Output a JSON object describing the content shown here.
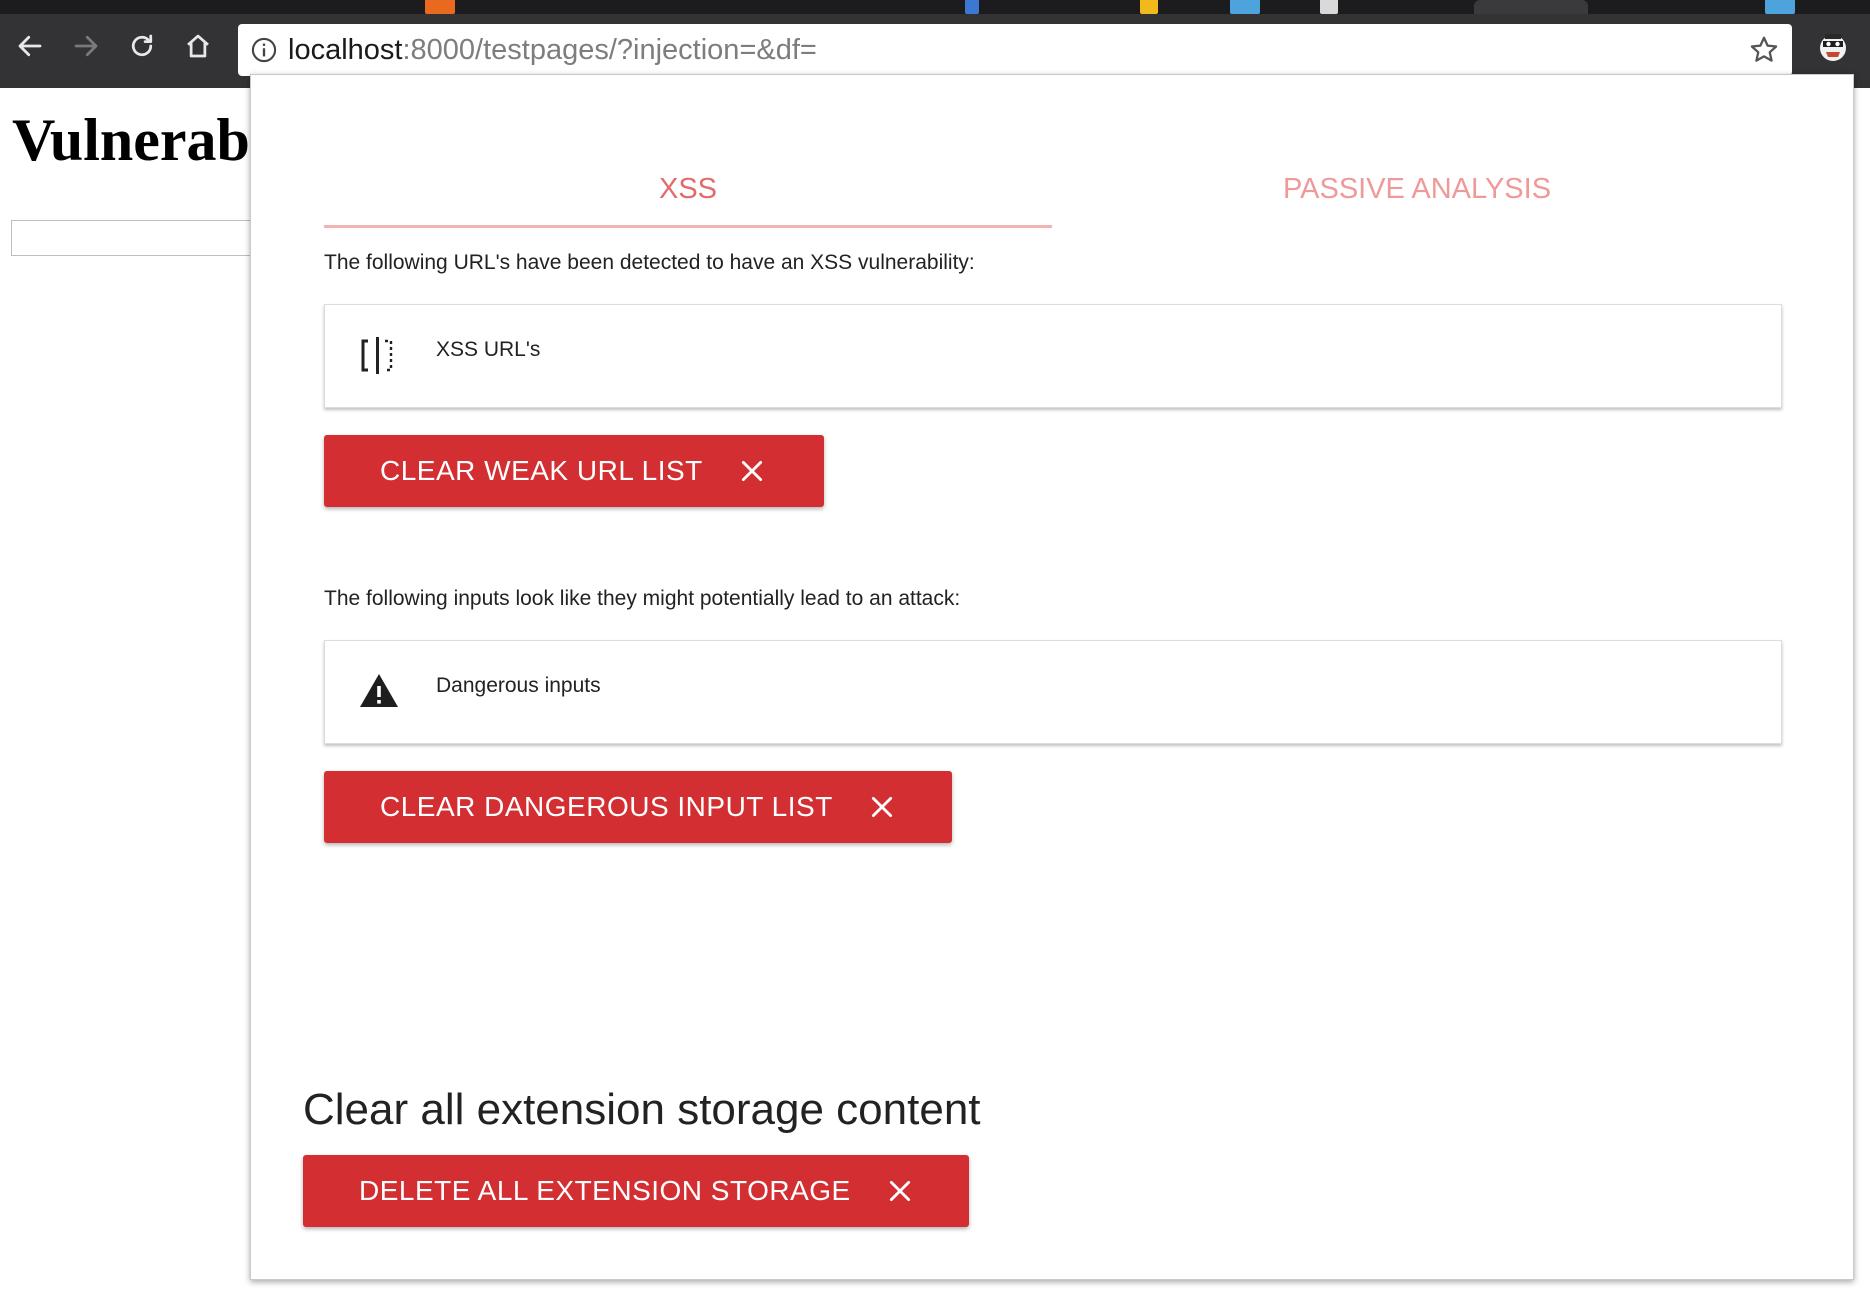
{
  "browser": {
    "url_host": "localhost",
    "url_rest": ":8000/testpages/?injection=&df=",
    "icons": [
      "back-icon",
      "forward-icon",
      "reload-icon",
      "home-icon",
      "info-icon",
      "star-icon",
      "extension-icon"
    ]
  },
  "page": {
    "heading": "Vulnerab"
  },
  "popup": {
    "tabs": [
      {
        "label": "XSS",
        "active": true
      },
      {
        "label": "PASSIVE ANALYSIS",
        "active": false
      }
    ],
    "xss_section": {
      "description": "The following URL's have been detected to have an XSS vulnerability:",
      "card_label": "XSS URL's",
      "card_icon": "split-view-icon",
      "button_label": "CLEAR WEAK URL LIST"
    },
    "inputs_section": {
      "description": "The following inputs look like they might potentially lead to an attack:",
      "card_label": "Dangerous inputs",
      "card_icon": "warning-icon",
      "button_label": "CLEAR DANGEROUS INPUT LIST"
    },
    "storage_section": {
      "title": "Clear all extension storage content",
      "button_label": "DELETE ALL EXTENSION STORAGE"
    }
  },
  "colors": {
    "accent_red": "#d32f33",
    "tab_active_text": "#e36b6b",
    "tab_inactive_text": "#ef9a9a",
    "toolbar": "#333336"
  }
}
